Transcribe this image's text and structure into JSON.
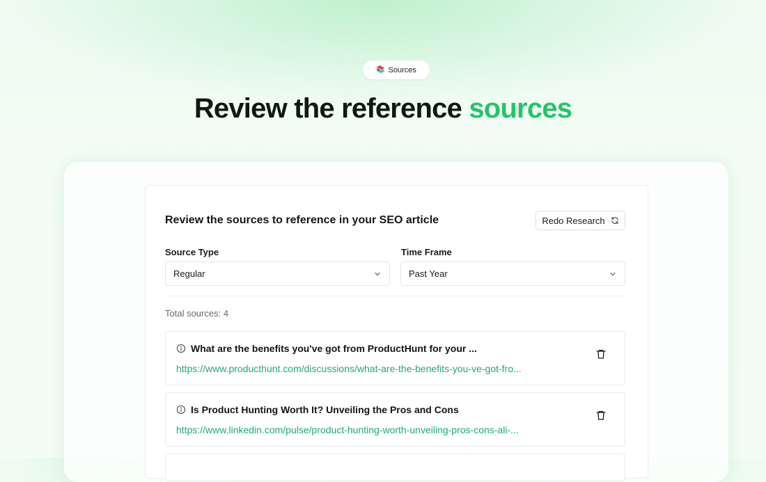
{
  "badge": {
    "icon": "books-icon",
    "icon_glyph": "📚",
    "label": "Sources"
  },
  "hero": {
    "title_prefix": "Review the reference ",
    "title_accent": "sources",
    "accent_color": "#22c56a"
  },
  "panel": {
    "title": "Review the sources to reference in your SEO article",
    "redo_label": "Redo Research",
    "redo_icon": "refresh-icon"
  },
  "filters": {
    "source_type": {
      "label": "Source Type",
      "value": "Regular"
    },
    "time_frame": {
      "label": "Time Frame",
      "value": "Past Year"
    }
  },
  "total_sources": "Total sources: 4",
  "sources": [
    {
      "title": "What are the benefits you've got from ProductHunt for your ...",
      "url": "https://www.producthunt.com/discussions/what-are-the-benefits-you-ve-got-fro..."
    },
    {
      "title": "Is Product Hunting Worth It? Unveiling the Pros and Cons",
      "url": "https://www.linkedin.com/pulse/product-hunting-worth-unveiling-pros-cons-ali-..."
    }
  ],
  "colors": {
    "link": "#1fa77e",
    "background": "#f3fcf5"
  }
}
